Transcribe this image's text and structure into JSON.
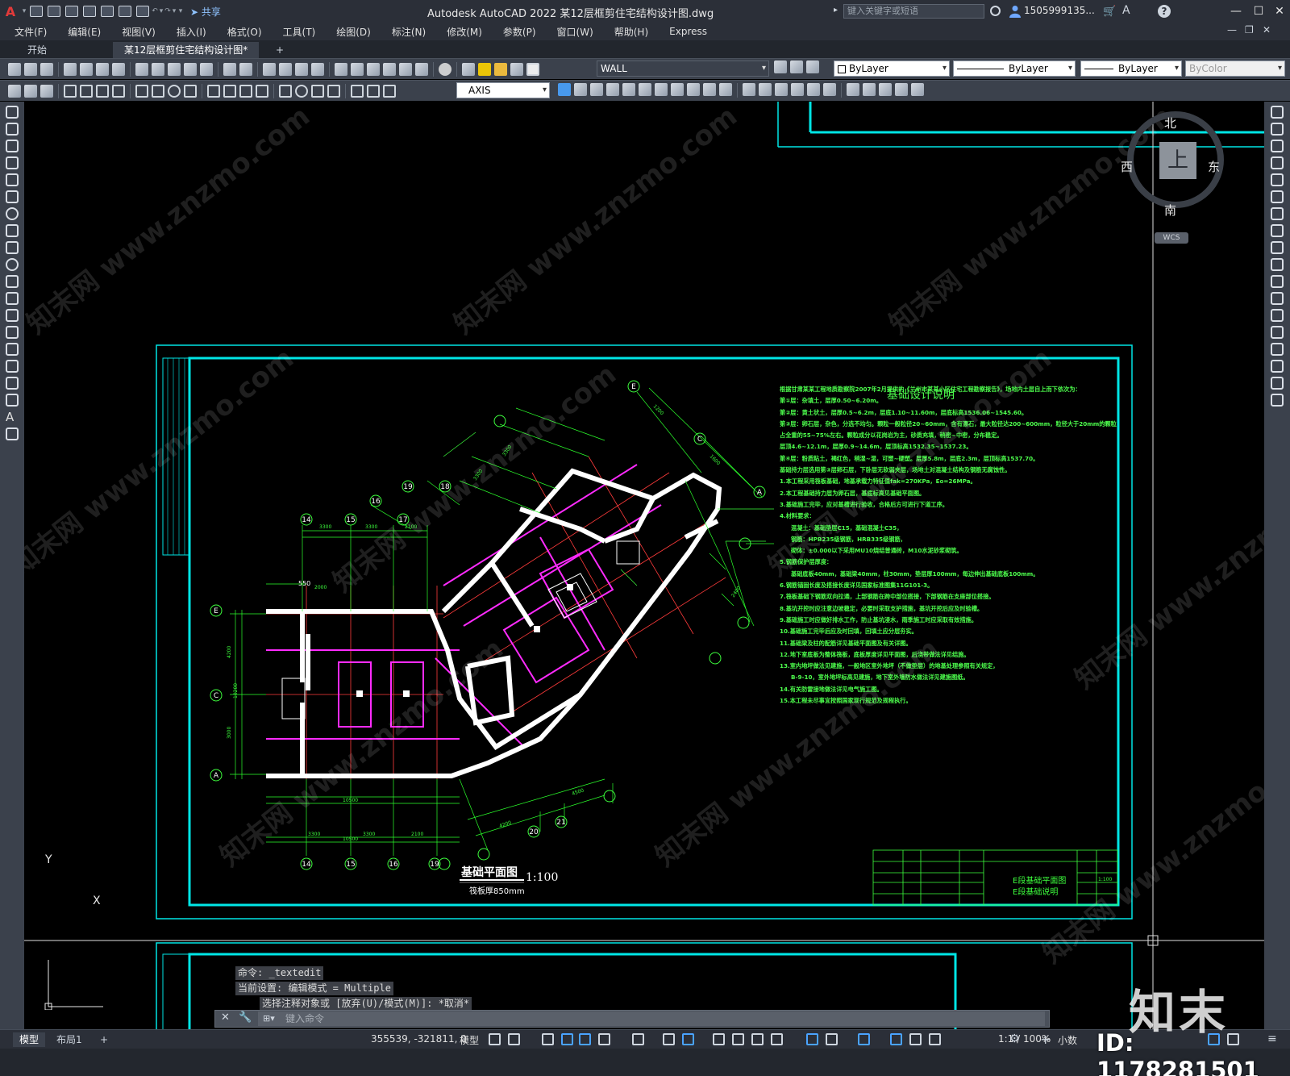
{
  "titlebar": {
    "logo": "A",
    "share_label": "共享",
    "doc_title": "Autodesk AutoCAD 2022    某12层框剪住宅结构设计图.dwg",
    "search_placeholder": "键入关键字或短语",
    "user_name": "1505999135...",
    "min": "—",
    "max": "☐",
    "close": "✕"
  },
  "menubar": [
    "文件(F)",
    "编辑(E)",
    "视图(V)",
    "插入(I)",
    "格式(O)",
    "工具(T)",
    "绘图(D)",
    "标注(N)",
    "修改(M)",
    "参数(P)",
    "窗口(W)",
    "帮助(H)",
    "Express"
  ],
  "tabs": {
    "start": "开始",
    "active": "某12层框剪住宅结构设计图*",
    "add": "+"
  },
  "toolbar": {
    "layer": "WALL",
    "color": "ByLayer",
    "linetype": "ByLayer",
    "lineweight": "ByLayer",
    "plotstyle": "ByColor",
    "dimstyle": "AXIS"
  },
  "viewcube": {
    "north": "北",
    "south": "南",
    "east": "东",
    "west": "西",
    "top": "上",
    "wcs": "WCS"
  },
  "drawing": {
    "notes_title": "基础设计说明",
    "notes": [
      "根据甘肃某某工程地质勘察院2007年2月提供的《兰州市某某小区住宅工程勘察报告》，场地内土层自上而下依次为：",
      "第①层：杂填土，层厚0.50~6.20m。",
      "第②层：黄土状土，层厚0.5~6.2m，层底1.10~11.60m，层底标高1536.06~1545.60。",
      "第③层：卵石层，杂色，分选不均匀。颗粒一般粒径20~60mm，含有漂石，最大粒径达200~600mm，粒径大于20mm的颗粒",
      "占全重的55~75%左右。颗粒成分以花岗岩为主，砂质充填，稍密~中密，分布稳定。",
      "层顶4.6~12.1m，层厚0.9~14.6m，层顶标高1532.35~1537.23。",
      "第④层：粉质粘土，褐红色，稍湿~湿，可塑~硬塑。层厚5.8m，层底2.3m，层顶标高1537.70。",
      "基础持力层选用第③层卵石层，下卧层无软弱夹层，场地土对混凝土结构及钢筋无腐蚀性。",
      "1.本工程采用筏板基础，地基承载力特征值fak=270KPa，Eo=26MPa。",
      "2.本工程基础持力层为卵石层，基底标高见基础平面图。",
      "3.基础施工完毕，应对基槽进行验收，合格后方可进行下道工序。",
      "4.材料要求：",
      "混凝土：基础垫层C15，基础混凝土C35，",
      "钢筋：HPB235级钢筋，HRB335级钢筋，",
      "砌体：±0.000以下采用MU10烧结普通砖，M10水泥砂浆砌筑。",
      "5.钢筋保护层厚度：",
      "基础底板40mm，基础梁40mm，柱30mm，垫层厚100mm，每边伸出基础底板100mm。",
      "6.钢筋锚固长度及搭接长度详见国家标准图集11G101-3。",
      "7.筏板基础下钢筋双向拉通，上部钢筋在跨中部位搭接，下部钢筋在支座部位搭接。",
      "8.基坑开挖时应注意边坡稳定，必要时采取支护措施，基坑开挖后应及时验槽。",
      "9.基础施工时应做好排水工作，防止基坑浸水，雨季施工时应采取有效措施。",
      "10.基础施工完毕后应及时回填，回填土应分层夯实。",
      "11.基础梁及柱的配筋详见基础平面图及有关详图。",
      "12.地下室底板为整体筏板，底板厚度详见平面图，后浇带做法详见结施。",
      "13.室内地坪做法见建施，一般地区室外地坪（不做垫层）的地基处理参照有关规定，",
      "B-9-10，室外地坪标高见建施，地下室外墙防水做法详见建施图纸。",
      "14.有关防雷接地做法详见电气施工图。",
      "15.本工程未尽事宜按照国家现行规范及规程执行。"
    ],
    "plan_title": "基础平面图",
    "plan_scale": "1:100",
    "plan_sub": "筏板厚850mm",
    "title_block": {
      "drawing_name_1": "E段基础平面图",
      "drawing_name_2": "E段基础说明",
      "scale": "1:100"
    },
    "axis_labels_bottom": [
      "14",
      "15",
      "16",
      "19",
      "20",
      "21"
    ],
    "axis_labels_top": [
      "14",
      "15",
      "16",
      "17",
      "18",
      "19"
    ],
    "axis_labels_left": [
      "E",
      "C",
      "A"
    ],
    "dim_550": "550"
  },
  "ucs": {
    "x": "X",
    "y": "Y"
  },
  "command": {
    "history_1": "命令: _textedit",
    "history_2": "当前设置: 编辑模式 = Multiple",
    "history_3": "选择注释对象或 [放弃(U)/模式(M)]: *取消*",
    "input_placeholder": "键入命令"
  },
  "statusbar": {
    "model_tab": "模型",
    "layout_tab": "布局1",
    "add": "+",
    "coords": "355539, -321811, 0",
    "model": "模型",
    "scale": "1:1 / 100%",
    "units": "小数"
  },
  "watermark": {
    "logo": "知末",
    "id": "ID: 1178281501",
    "diagonal": "知末网 www.znzmo.com"
  }
}
